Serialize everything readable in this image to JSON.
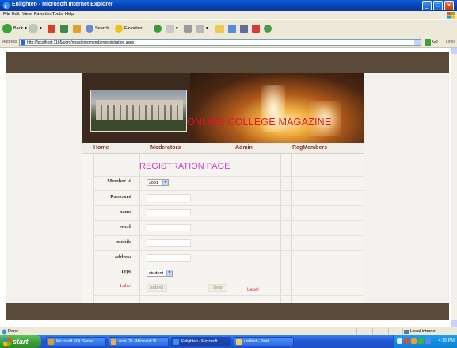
{
  "window": {
    "title": "Enlighten - Microsoft Internet Explorer"
  },
  "menu": [
    "File",
    "Edit",
    "View",
    "Favorites",
    "Tools",
    "Help"
  ],
  "toolbar": {
    "back": "Back",
    "search": "Search",
    "favorites": "Favorites"
  },
  "address": {
    "label": "Address",
    "url": "http://localhost:1165/ocm/registeredmember/registration.aspx",
    "go": "Go",
    "links": "Links"
  },
  "banner": {
    "title": "ONLINE COLLEGE MAGAZINE"
  },
  "nav": [
    "Home",
    "Moderators",
    "Admin",
    "RegMembers"
  ],
  "form": {
    "heading": "REGISTRATION PAGE",
    "labels": {
      "member_id": "Member id",
      "password": "Password",
      "name": "name",
      "email": "email",
      "mobile": "mobile",
      "address": "address",
      "type": "Type",
      "label": "Label"
    },
    "member_id_value": "s001",
    "type_value": "student",
    "submit": "submit",
    "clear": "clear",
    "status_label": "Label"
  },
  "status": {
    "text": "Done",
    "zone": "Local intranet"
  },
  "taskbar": {
    "start": "start",
    "tasks": [
      "Microsoft SQL Server ...",
      "ocm (2) - Microsoft Vi...",
      "Enlighten - Microsoft ...",
      "untitled - Paint"
    ],
    "clock": "4:16 PM"
  },
  "colors": {
    "accent": "#cc3fcc",
    "title_red": "#e8102a",
    "nav_text": "#7a3a2a",
    "frame_brown": "#5a4a3a"
  }
}
